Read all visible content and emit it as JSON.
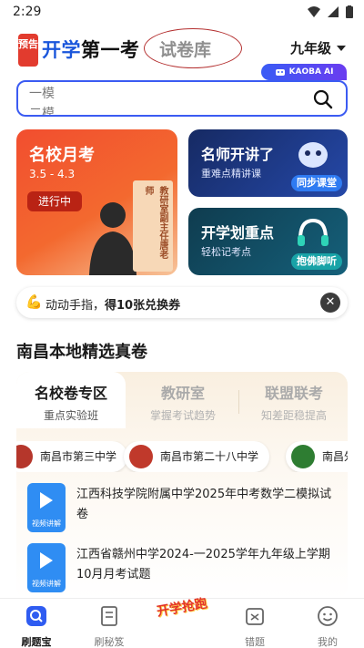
{
  "status": {
    "time": "2:29"
  },
  "header": {
    "badge": "预告",
    "brand_prefix": "开学",
    "brand_suffix": "第一考",
    "tab_active": "试卷库",
    "grade": "九年级"
  },
  "search": {
    "ai_tag": "KAOBA AI",
    "line1": "一模",
    "line2": "二模"
  },
  "promo": {
    "main": {
      "title": "名校月考",
      "dates": "3.5 - 4.3",
      "status": "进行中",
      "book": "教研室副主任",
      "teacher": "唐老师"
    },
    "card1": {
      "title": "名师开讲了",
      "sub": "重难点精讲课",
      "button": "同步课堂"
    },
    "card2": {
      "title": "开学划重点",
      "sub": "轻松记考点",
      "button": "抱佛脚听"
    }
  },
  "reward": {
    "prefix": "动动手指，",
    "bold": "得10张兑换券"
  },
  "section": {
    "title": "南昌本地精选真卷",
    "tabs": [
      {
        "label": "名校卷专区",
        "sub": "重点实验班"
      },
      {
        "label": "教研室",
        "sub": "掌握考试趋势"
      },
      {
        "label": "联盟联考",
        "sub": "知差距稳提高"
      }
    ],
    "schools": [
      "南昌市第三中学",
      "南昌市第二十八中学",
      "南昌外"
    ],
    "papers": [
      {
        "title": "江西科技学院附属中学2025年中考数学二模拟试卷",
        "thumb_label": "视频讲解"
      },
      {
        "title": "江西省赣州中学2024-一2025学年九年级上学期10月月考试题",
        "thumb_label": "视频讲解"
      }
    ]
  },
  "nav": {
    "items": [
      "刷题宝",
      "刷秘笈",
      "开学抢跑",
      "错题",
      "我的"
    ]
  },
  "colors": {
    "accent": "#3b5bf2",
    "promo_red": "#f24e2f",
    "brand_blue": "#1a56db"
  }
}
